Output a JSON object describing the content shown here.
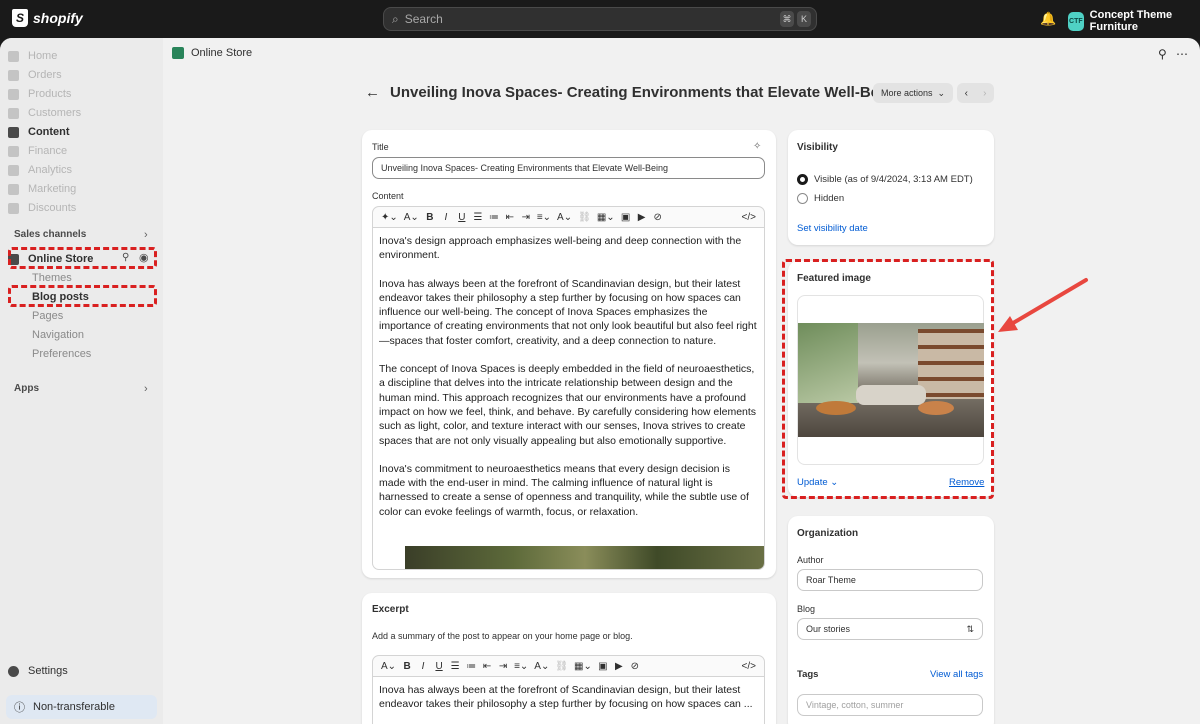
{
  "topbar": {
    "brand": "shopify",
    "search_placeholder": "Search",
    "kbd1": "⌘",
    "kbd2": "K",
    "store_initials": "CTF",
    "store_name": "Concept Theme Furniture"
  },
  "sidebar": {
    "items": [
      {
        "label": "Home",
        "icon": "home-icon"
      },
      {
        "label": "Orders",
        "icon": "orders-icon"
      },
      {
        "label": "Products",
        "icon": "products-icon"
      },
      {
        "label": "Customers",
        "icon": "customers-icon"
      },
      {
        "label": "Content",
        "icon": "content-icon"
      },
      {
        "label": "Finance",
        "icon": "finance-icon"
      },
      {
        "label": "Analytics",
        "icon": "analytics-icon"
      },
      {
        "label": "Marketing",
        "icon": "marketing-icon"
      },
      {
        "label": "Discounts",
        "icon": "discounts-icon"
      }
    ],
    "sales_channels_label": "Sales channels",
    "online_store_label": "Online Store",
    "online_store_sub": [
      "Themes",
      "Blog posts",
      "Pages",
      "Navigation",
      "Preferences"
    ],
    "apps_label": "Apps",
    "settings_label": "Settings",
    "non_transferable_label": "Non-transferable"
  },
  "header": {
    "section": "Online Store",
    "page_title": "Unveiling Inova Spaces- Creating Environments that Elevate Well-Being",
    "more_actions": "More actions"
  },
  "editor": {
    "title_label": "Title",
    "title_value": "Unveiling Inova Spaces- Creating Environments that Elevate Well-Being",
    "content_label": "Content",
    "paragraphs": [
      "Inova's design approach emphasizes well-being and deep connection with the environment.",
      "Inova has always been at the forefront of Scandinavian design, but their latest endeavor takes their philosophy a step further by focusing on how spaces can influence our well-being. The concept of Inova Spaces emphasizes the importance of creating environments that not only look beautiful but also feel right—spaces that foster comfort, creativity, and a deep connection to nature.",
      "The concept of Inova Spaces is deeply embedded in the field of neuroaesthetics, a discipline that delves into the intricate relationship between design and the human mind. This approach recognizes that our environments have a profound impact on how we feel, think, and behave. By carefully considering how elements such as light, color, and texture interact with our senses, Inova strives to create spaces that are not only visually appealing but also emotionally supportive.",
      "Inova's commitment to neuroaesthetics means that every design decision is made with the end-user in mind. The calming influence of natural light is harnessed to create a sense of openness and tranquility, while the subtle use of color can evoke feelings of warmth, focus, or relaxation."
    ]
  },
  "excerpt": {
    "label": "Excerpt",
    "help": "Add a summary of the post to appear on your home page or blog.",
    "text": "Inova has always been at the forefront of Scandinavian design, but their latest endeavor takes their philosophy a step further by focusing on how spaces can ..."
  },
  "visibility": {
    "title": "Visibility",
    "visible_label": "Visible (as of 9/4/2024, 3:13 AM EDT)",
    "hidden_label": "Hidden",
    "set_date_link": "Set visibility date"
  },
  "featured_image": {
    "title": "Featured image",
    "update": "Update",
    "remove": "Remove"
  },
  "organization": {
    "title": "Organization",
    "author_label": "Author",
    "author_value": "Roar Theme",
    "blog_label": "Blog",
    "blog_value": "Our stories",
    "tags_label": "Tags",
    "view_all_tags": "View all tags",
    "tags_placeholder": "Vintage, cotton, summer"
  },
  "colors": {
    "highlight": "#d92020",
    "arrow": "#e8473f",
    "link": "#005bd3"
  }
}
